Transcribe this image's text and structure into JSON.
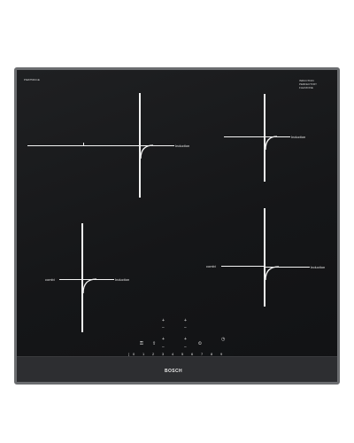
{
  "model_code": "PIE675DC1E",
  "top_right": {
    "line1": "INDUCTION",
    "line2": "PERFECTFRY",
    "line3": "FLEXZONE"
  },
  "zones": [
    {
      "id": "rear-left",
      "label": "Induction"
    },
    {
      "id": "rear-right",
      "label": "Induction"
    },
    {
      "id": "front-left",
      "label": "Induction",
      "left_label": "combi"
    },
    {
      "id": "front-right",
      "label": "Induction",
      "left_label": "combi"
    }
  ],
  "control_panel": {
    "numbers": [
      "0",
      "1",
      "2",
      "3",
      "4",
      "5",
      "6",
      "7",
      "8",
      "9"
    ],
    "brand": "BOSCH"
  }
}
